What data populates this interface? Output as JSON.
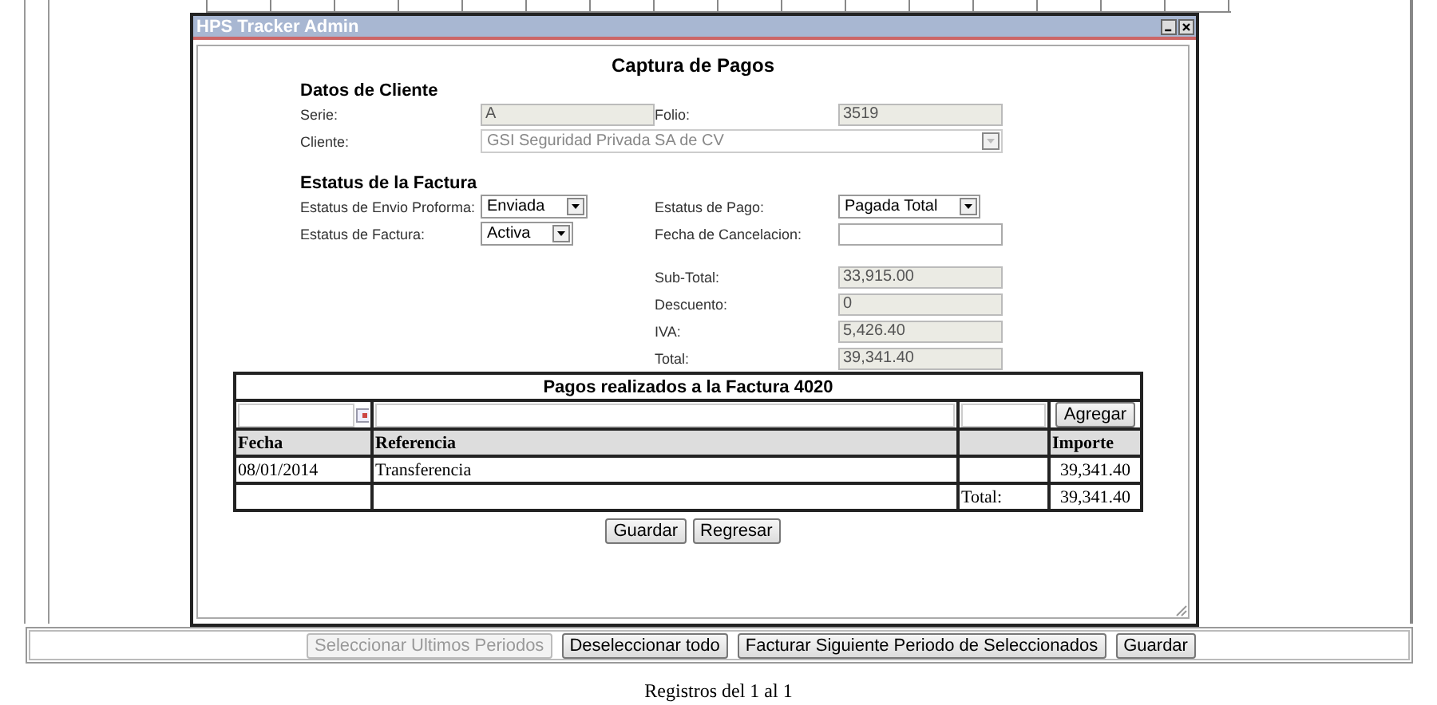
{
  "dialog": {
    "title": "HPS Tracker Admin",
    "heading": "Captura de Pagos",
    "client": {
      "heading": "Datos de Cliente",
      "rows": [
        [
          {
            "label": "Serie:",
            "kind": "text",
            "value": "A",
            "disabled": true
          },
          {
            "label": "Folio:",
            "kind": "text",
            "value": "3519",
            "disabled": true
          }
        ],
        [
          {
            "label": "Cliente:",
            "kind": "select",
            "value": "GSI Seguridad Privada SA de CV",
            "disabled": true
          }
        ]
      ]
    },
    "invoice": {
      "heading": "Estatus de la Factura",
      "rows": [
        [
          {
            "label": "Estatus de Envio Proforma:",
            "kind": "select",
            "value": "Enviada",
            "disabled": false
          },
          {
            "label": "Estatus de Pago:",
            "kind": "select",
            "value": "Pagada Total",
            "disabled": false
          }
        ],
        [
          {
            "label": "Estatus de Factura:",
            "kind": "select",
            "value": "Activa",
            "disabled": false
          },
          {
            "label": "Fecha de Cancelacion:",
            "kind": "text",
            "disabled": false
          }
        ]
      ]
    },
    "totals": [
      {
        "label": "Sub-Total:",
        "value": "33,915.00"
      },
      {
        "label": "Descuento:",
        "value": "0"
      },
      {
        "label": "IVA:",
        "value": "5,426.40"
      },
      {
        "label": "Total:",
        "value": "39,341.40"
      }
    ],
    "payments": {
      "title": "Pagos realizados a la Factura 4020",
      "add_button": "Agregar",
      "columns": {
        "fecha": "Fecha",
        "referencia": "Referencia",
        "importe": "Importe"
      },
      "rows": [
        {
          "fecha": "08/01/2014",
          "referencia": "Transferencia",
          "importe": "39,341.40"
        }
      ],
      "total": {
        "label": "Total:",
        "value": "39,341.40"
      }
    },
    "buttons": [
      "Guardar",
      "Regresar"
    ]
  },
  "toolbar": [
    {
      "label": "Seleccionar Ultimos Periodos",
      "disabled": true
    },
    {
      "label": "Deseleccionar todo",
      "disabled": false
    },
    {
      "label": "Facturar Siguiente Periodo de Seleccionados",
      "disabled": false
    },
    {
      "label": "Guardar",
      "disabled": false
    }
  ],
  "footer": "Registros del 1 al 1"
}
